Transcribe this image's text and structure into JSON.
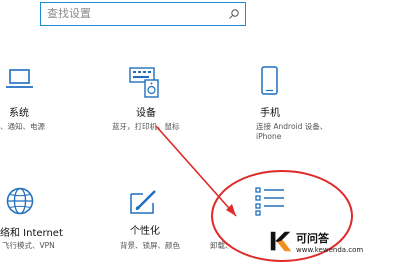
{
  "search": {
    "placeholder": "查找设置"
  },
  "tiles": {
    "system": {
      "title": "系统",
      "desc": "、通知、电源",
      "icon": "laptop-icon"
    },
    "devices": {
      "title": "设备",
      "desc": "蓝牙，打印机，鼠标",
      "icon": "keyboard-speaker-icon"
    },
    "phone": {
      "title": "手机",
      "desc_line1": "连接 Android 设备、",
      "desc_line2": "iPhone",
      "icon": "phone-icon"
    },
    "network": {
      "title": "络和 Internet",
      "desc": "飞行模式、VPN",
      "icon": "globe-icon"
    },
    "personalization": {
      "title": "个性化",
      "desc": "背景、锁屏、颜色",
      "icon": "paint-brush-icon"
    },
    "apps": {
      "desc": "卸载、",
      "icon": "list-icon"
    }
  },
  "watermark": {
    "brand": "可问答",
    "url": "www.kewenda.com"
  },
  "colors": {
    "accent": "#1f6fbf",
    "annotation_red": "#e02a2a",
    "search_border": "#1f8ad6"
  }
}
